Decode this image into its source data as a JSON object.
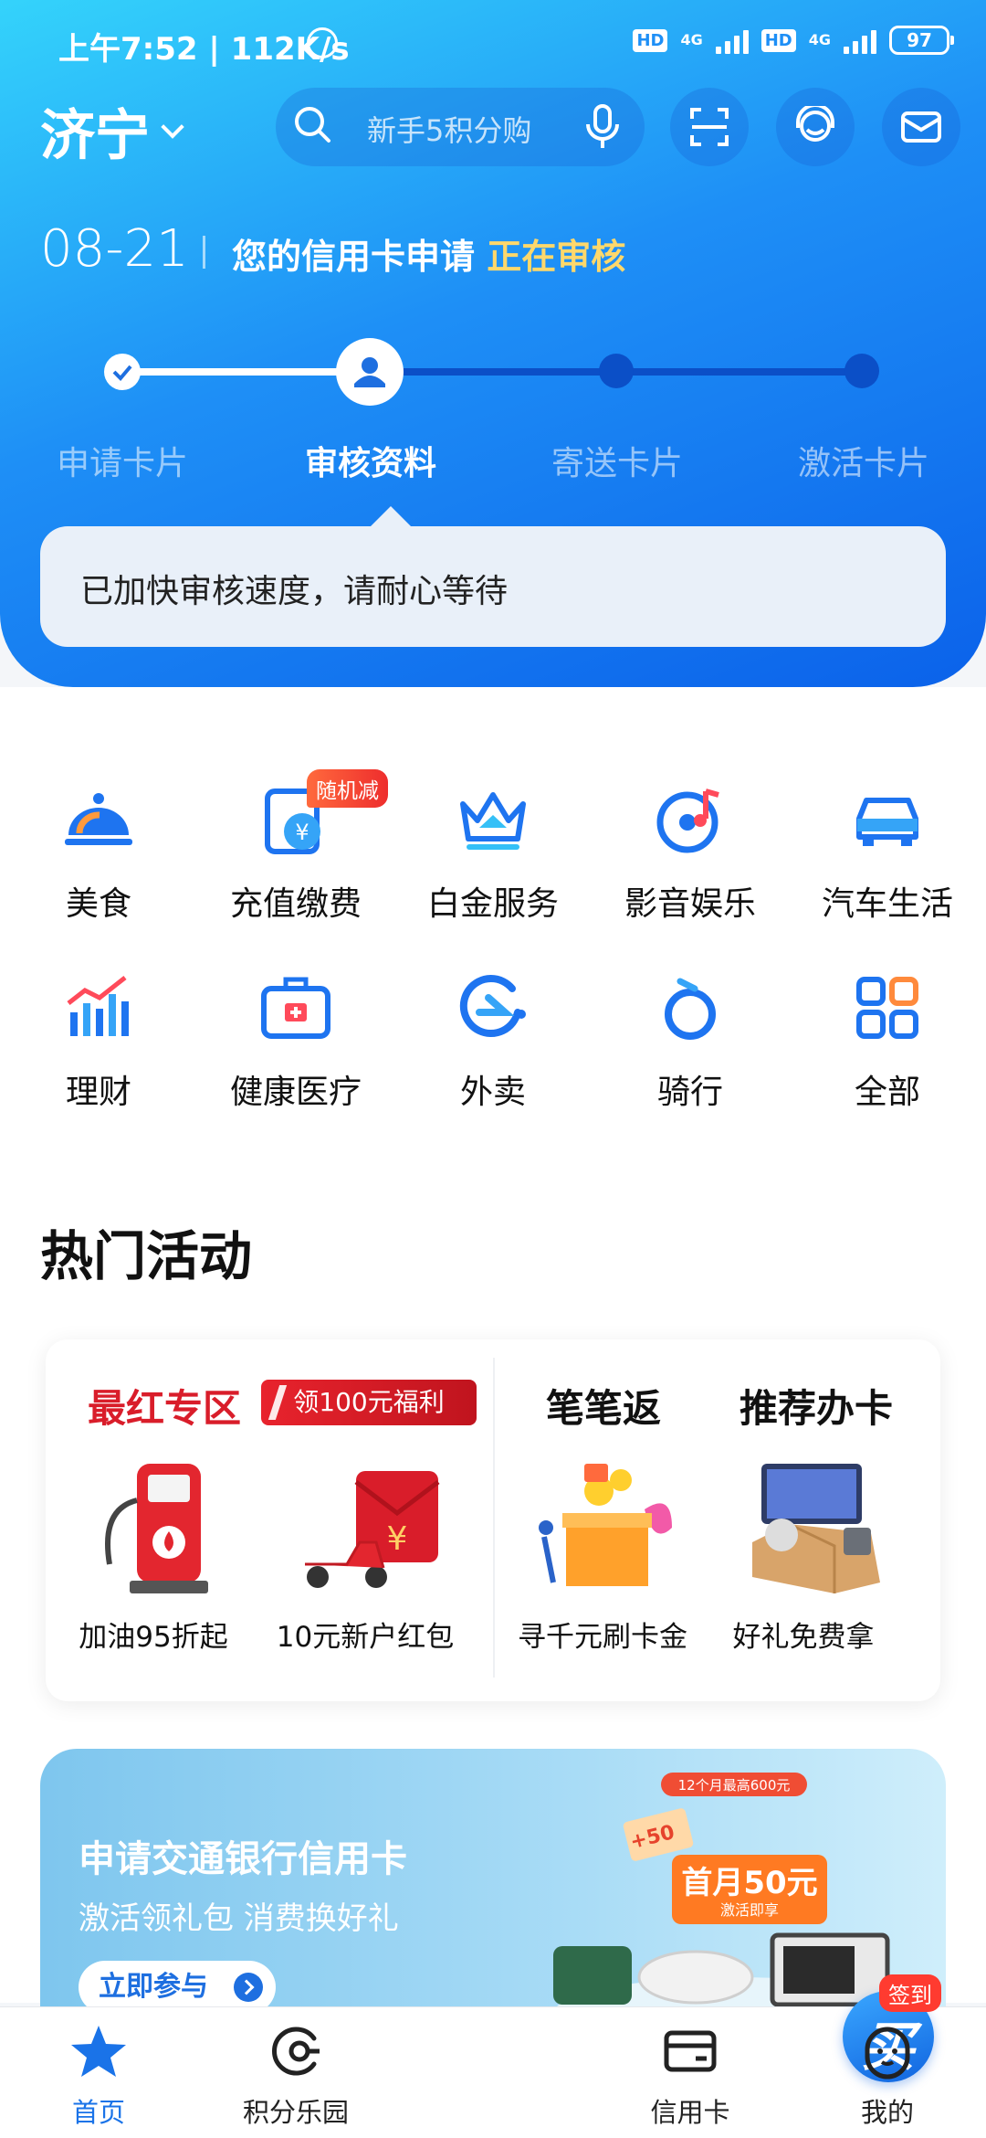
{
  "status_bar": {
    "time": "上午7:52 | 112K/s",
    "hd1": "HD",
    "net1": "4G",
    "hd2": "HD",
    "net2": "4G",
    "battery": "97"
  },
  "header": {
    "city": "济宁",
    "search_placeholder": "新手5积分购"
  },
  "application": {
    "date": "08-21",
    "status_prefix": "您的信用卡申请",
    "status_highlight": "正在审核",
    "steps": [
      "申请卡片",
      "审核资料",
      "寄送卡片",
      "激活卡片"
    ],
    "current_step": 2,
    "tip": "已加快审核速度，请耐心等待"
  },
  "services": [
    {
      "label": "美食",
      "icon": "cloche-icon"
    },
    {
      "label": "充值缴费",
      "icon": "topup-icon",
      "badge": "随机减"
    },
    {
      "label": "白金服务",
      "icon": "crown-icon"
    },
    {
      "label": "影音娱乐",
      "icon": "music-disc-icon"
    },
    {
      "label": "汽车生活",
      "icon": "car-icon"
    },
    {
      "label": "理财",
      "icon": "chart-icon"
    },
    {
      "label": "健康医疗",
      "icon": "medical-kit-icon"
    },
    {
      "label": "外卖",
      "icon": "delivery-e-icon"
    },
    {
      "label": "骑行",
      "icon": "bike-icon"
    },
    {
      "label": "全部",
      "icon": "grid-icon"
    }
  ],
  "hot": {
    "title": "热门活动",
    "red_zone_title": "最红专区",
    "red_zone_tag": "领100元福利",
    "items": [
      {
        "caption": "加油95折起"
      },
      {
        "caption": "10元新户红包"
      }
    ],
    "cashback_title": "笔笔返",
    "cashback_caption": "寻千元刷卡金",
    "recommend_title": "推荐办卡",
    "recommend_caption": "好礼免费拿"
  },
  "promo": {
    "title": "申请交通银行信用卡",
    "subtitle": "激活领礼包 消费换好礼",
    "button": "立即参与",
    "art_top": "12个月最高600元",
    "art_main": "首月50元",
    "art_sub": "激活即享",
    "coupon": "+50"
  },
  "tabbar": {
    "tabs": [
      "首页",
      "积分乐园",
      "",
      "信用卡",
      "我的"
    ],
    "center_badge": "签到",
    "center_glyph": "买",
    "active_color": "#1a73e8"
  }
}
